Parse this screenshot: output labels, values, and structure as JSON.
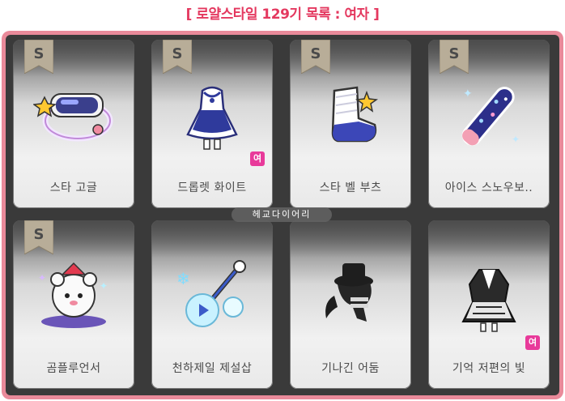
{
  "header": {
    "title": "[ 로얄스타일 129기 목록 : 여자 ]"
  },
  "colors": {
    "accent": "#e4385f",
    "frame": "#e98a9a",
    "female_badge": "#e83a9a"
  },
  "watermark": "헤교다이어리",
  "items": [
    {
      "grade": "S",
      "name": "스타 고글",
      "icon": "star-goggles-icon",
      "female": ""
    },
    {
      "grade": "S",
      "name": "드롭렛 화이트",
      "icon": "droplet-white-dress-icon",
      "female": "여"
    },
    {
      "grade": "S",
      "name": "스타 벨 부츠",
      "icon": "star-bell-boots-icon",
      "female": ""
    },
    {
      "grade": "S",
      "name": "아이스 스노우보..",
      "icon": "ice-snowboard-icon",
      "female": ""
    },
    {
      "grade": "S",
      "name": "곰플루언서",
      "icon": "bear-influencer-icon",
      "female": ""
    },
    {
      "grade": "",
      "name": "천하제일 제설삽",
      "icon": "snow-shovel-icon",
      "female": ""
    },
    {
      "grade": "",
      "name": "기나긴 어둠",
      "icon": "long-darkness-hat-icon",
      "female": ""
    },
    {
      "grade": "",
      "name": "기억 저편의 빛",
      "icon": "memory-light-outfit-icon",
      "female": "여"
    }
  ]
}
